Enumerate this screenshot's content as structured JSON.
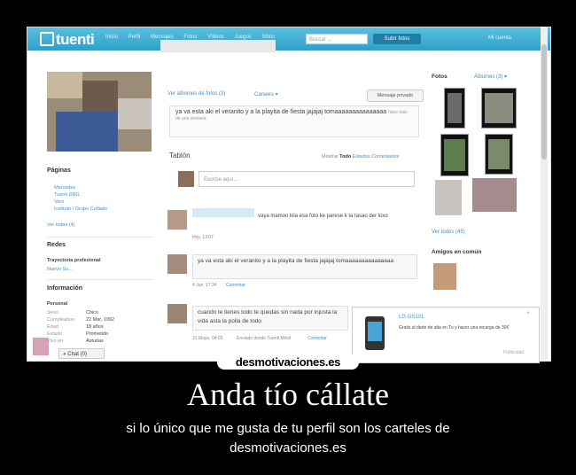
{
  "header": {
    "logo": "tuenti",
    "nav": [
      "Inicio",
      "Perfil",
      "Mensajes",
      "Fotos",
      "Vídeos",
      "Juegos",
      "Sitios"
    ],
    "search_placeholder": "Buscar ...",
    "upload_button": "Subir fotos",
    "user_menu": "Mi cuenta"
  },
  "profile": {
    "albums_link": "Ver álbumes de fotos (3)",
    "channels": "Canales ▾",
    "private_message": "Mensaje privado",
    "status_text": "ya va esta aki el veranito y a la playita de fiesta jajajaj tomaaaaaaaaaaaaaaa",
    "status_meta": "hace más de una semana"
  },
  "sidebar": {
    "pages_title": "Páginas",
    "pages": [
      "Mercedes",
      "Tuenti DNG",
      "Vero",
      "Instituto / Grupo Cuñado"
    ],
    "see_all_pages": "Ver todas (4)",
    "networks_title": "Redes",
    "networks_subtitle": "Trayectoria profesional",
    "networks_item": "Nuevo Su...",
    "info_title": "Información",
    "info_subtitle": "Personal",
    "info_rows": [
      {
        "label": "Sexo",
        "value": "Chico"
      },
      {
        "label": "Cumpleaños",
        "value": "22 Mar, 1992"
      },
      {
        "label": "Edad",
        "value": "18 años"
      },
      {
        "label": "Estado",
        "value": "Prometido"
      },
      {
        "label": "Vivo en",
        "value": "Asturias"
      }
    ]
  },
  "wall": {
    "title": "Tablón",
    "filters": {
      "label": "Mostrar",
      "active": "Todo",
      "items": [
        "Estados",
        "Comentarios"
      ]
    },
    "compose_placeholder": "Escribe aquí...",
    "posts": [
      {
        "text": "vaya mamon kila esa foto ke parese k ta tasao der loxo",
        "meta": "Hoy, 13:07",
        "comment": "",
        "quote": ""
      },
      {
        "text": "",
        "meta": "4 Jun, 17:34",
        "comment": "Comentar",
        "quote": "ya va esta aki el veranito y a la playita de fiesta jajajaj tomaaaaaaaaaaaaaaa"
      },
      {
        "text": "",
        "meta": "31 Mayo, 04:03",
        "comment": "Comentar",
        "meta_extra": "Enviado desde Tuenti Móvil",
        "quote": "cuando le tienes todo te quedas sin nada por injusta la vida asta la polla de todo"
      }
    ]
  },
  "right": {
    "photos_title": "Fotos",
    "albums": "Álbumes (3) ▾",
    "friends_link": "Ver todos (45)",
    "common_title": "Amigos en común"
  },
  "ad": {
    "title": "LG GS101",
    "body": "Gratis al darte de alta en Tu y hacer una recarga de 30€",
    "publicity": "Publicidad"
  },
  "chat": {
    "label": "Chat",
    "count": "(0)"
  },
  "poster": {
    "brand": "desmotivaciones.es",
    "title": "Anda tío cállate",
    "subtitle": "si lo único que me gusta de tu perfil son los carteles de desmotivaciones.es"
  }
}
